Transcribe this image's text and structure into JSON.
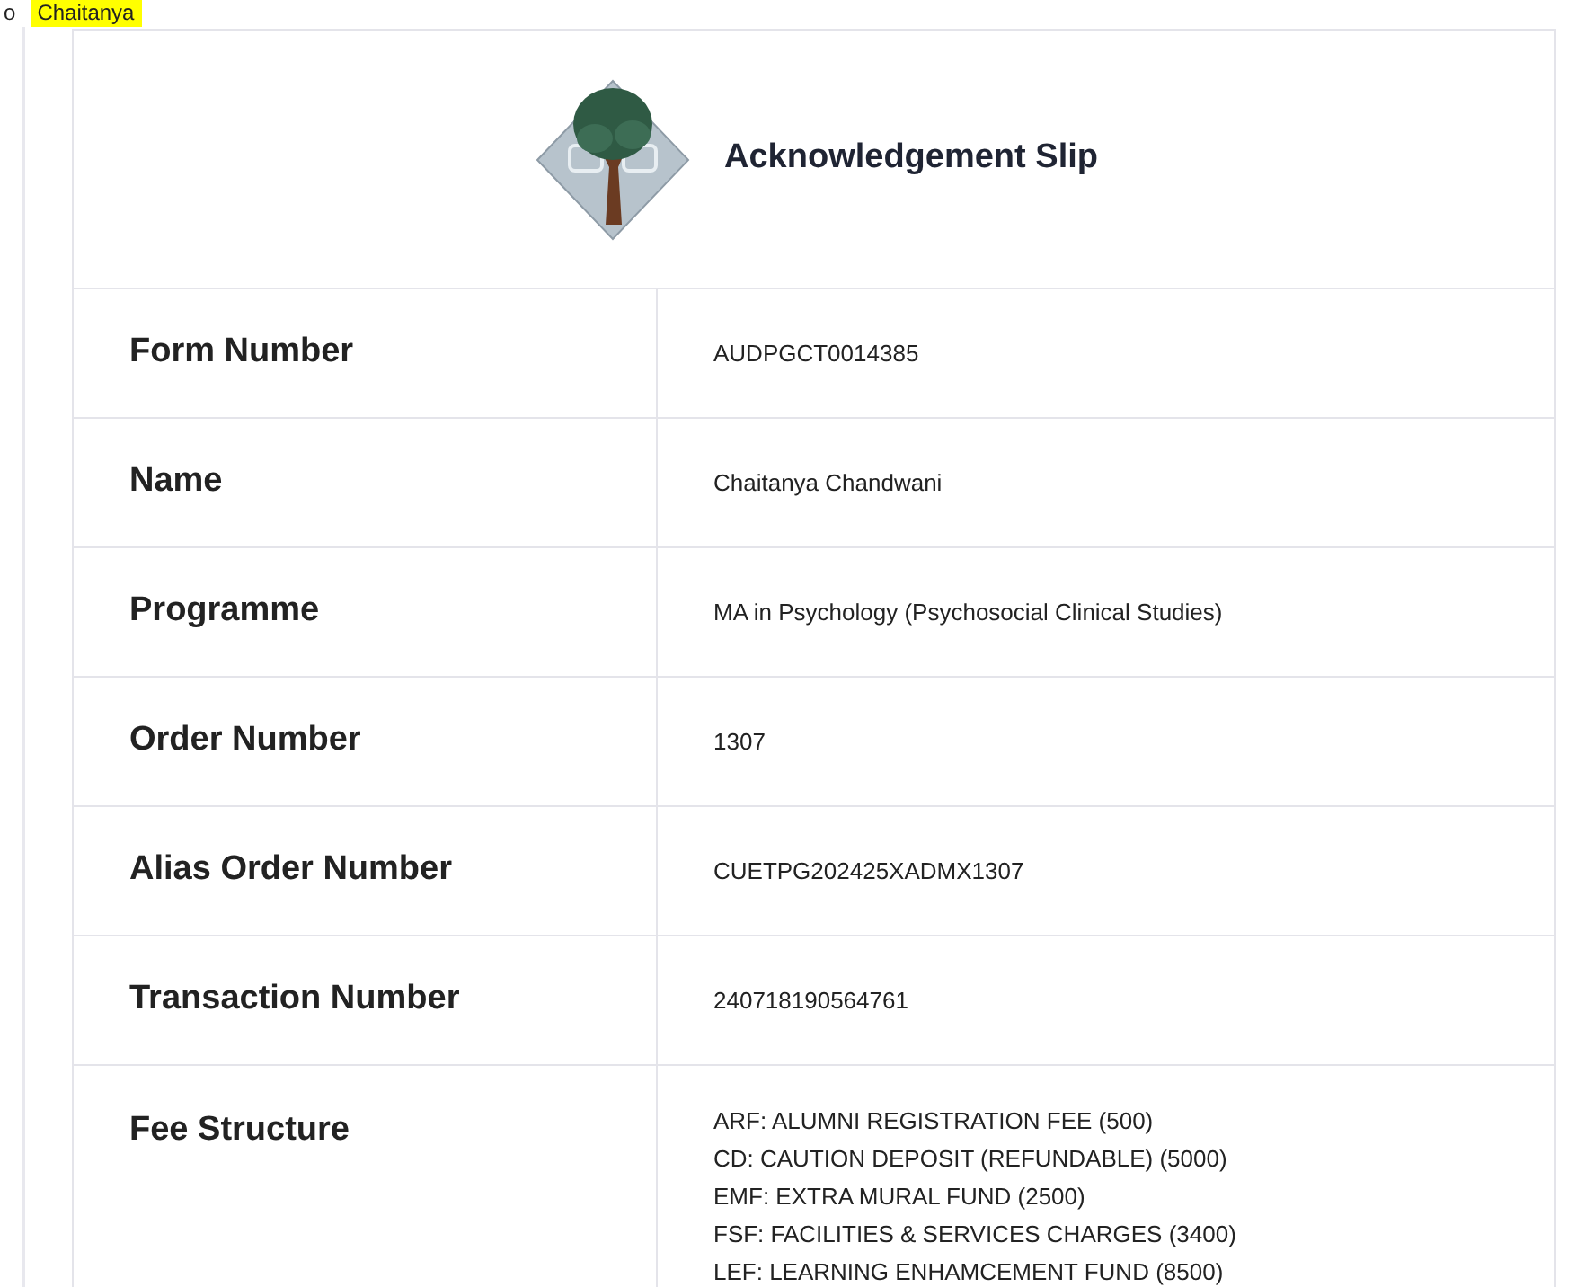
{
  "list_item": {
    "bullet": "o",
    "text": "Chaitanya",
    "highlighted": true
  },
  "slip": {
    "title": "Acknowledgement Slip",
    "rows": [
      {
        "label": "Form Number",
        "value": "AUDPGCT0014385"
      },
      {
        "label": "Name",
        "value": "Chaitanya Chandwani"
      },
      {
        "label": "Programme",
        "value": "MA in Psychology (Psychosocial Clinical Studies)"
      },
      {
        "label": "Order Number",
        "value": "1307"
      },
      {
        "label": "Alias Order Number",
        "value": "CUETPG202425XADMX1307"
      },
      {
        "label": "Transaction Number",
        "value": "240718190564761"
      }
    ],
    "fee_structure": {
      "label": "Fee Structure",
      "items": [
        "ARF: ALUMNI REGISTRATION FEE (500)",
        "CD: CAUTION DEPOSIT (REFUNDABLE) (5000)",
        "EMF: EXTRA MURAL FUND (2500)",
        "FSF: FACILITIES & SERVICES CHARGES (3400)",
        "LEF: LEARNING ENHAMCEMENT FUND (8500)"
      ]
    }
  }
}
